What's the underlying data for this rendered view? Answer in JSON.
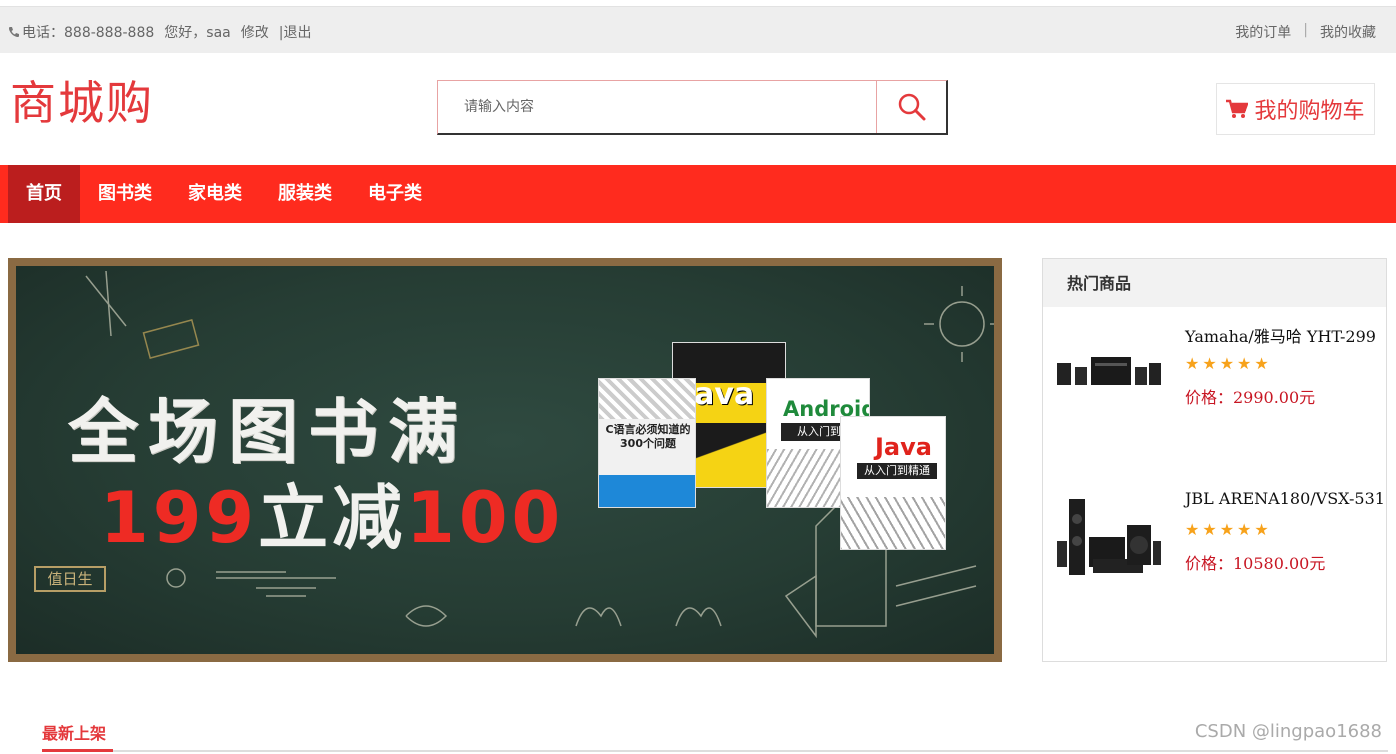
{
  "topbar": {
    "phone": "电话：888-888-888",
    "greeting": "您好，saa",
    "edit": "修改",
    "logout": "|退出",
    "orders": "我的订单",
    "separator": "|",
    "favorites": "我的收藏"
  },
  "header": {
    "logo": "商城购",
    "search_placeholder": "请输入内容",
    "cart": "我的购物车"
  },
  "nav": {
    "items": [
      {
        "label": "首页",
        "active": true
      },
      {
        "label": "图书类"
      },
      {
        "label": "家电类"
      },
      {
        "label": "服装类"
      },
      {
        "label": "电子类"
      }
    ]
  },
  "banner": {
    "line1": "全场图书满",
    "line2_a": "199",
    "line2_b": "立减",
    "line2_c": "100",
    "duty": "值日生",
    "books": [
      "C语言必须知道的300个问题",
      "Java",
      "Android",
      "Java"
    ]
  },
  "hot": {
    "title": "热门商品",
    "products": [
      {
        "name": "Yamaha/雅马哈 YHT-299",
        "rating": "★★★★★",
        "price": "价格：2990.00元"
      },
      {
        "name": "JBL ARENA180/VSX-531",
        "rating": "★★★★★",
        "price": "价格：10580.00元"
      }
    ]
  },
  "newest": {
    "title": "最新上架"
  },
  "watermark": "CSDN @lingpao1688",
  "colors": {
    "brand": "#e4393c",
    "nav": "#ff2b1e",
    "nav_active": "#bb1e1e",
    "star": "#f7a21b"
  }
}
